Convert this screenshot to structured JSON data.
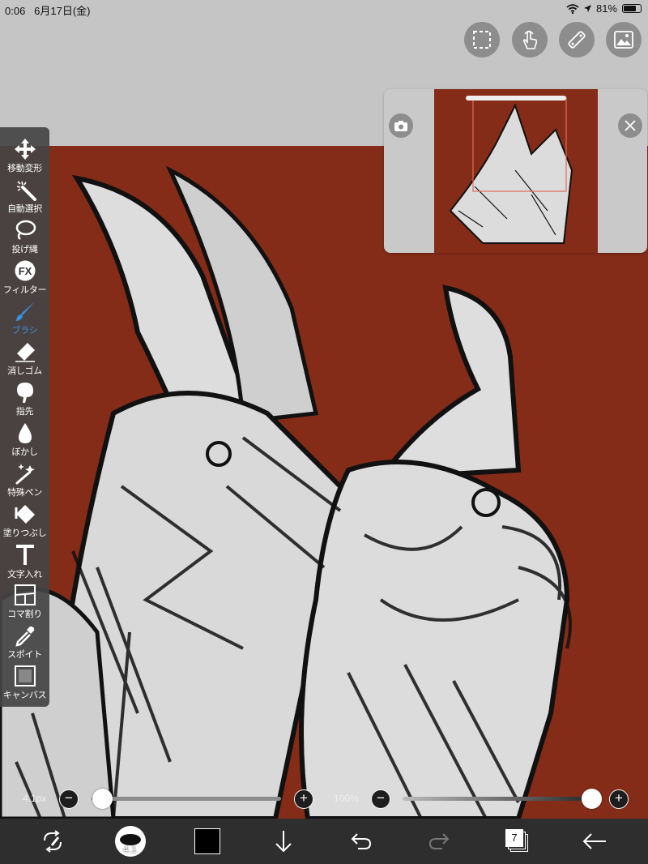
{
  "status_bar": {
    "time": "0:06",
    "date": "6月17日(金)",
    "battery": "81%",
    "battery_level": 0.81
  },
  "top_tools": [
    {
      "name": "selection-icon"
    },
    {
      "name": "gesture-icon"
    },
    {
      "name": "ruler-icon"
    },
    {
      "name": "gallery-icon"
    }
  ],
  "navigator": {
    "camera_icon": "camera-icon",
    "close_icon": "close-icon"
  },
  "toolbar": {
    "active": "brush",
    "items": [
      {
        "id": "move",
        "label": "移動変形",
        "icon": "move-icon"
      },
      {
        "id": "magic",
        "label": "自動選択",
        "icon": "magic-wand-icon"
      },
      {
        "id": "lasso",
        "label": "投げ縄",
        "icon": "lasso-icon"
      },
      {
        "id": "filter",
        "label": "フィルター",
        "icon": "fx-icon"
      },
      {
        "id": "brush",
        "label": "ブラシ",
        "icon": "brush-icon"
      },
      {
        "id": "eraser",
        "label": "消しゴム",
        "icon": "eraser-icon"
      },
      {
        "id": "smudge",
        "label": "指先",
        "icon": "finger-icon"
      },
      {
        "id": "blur",
        "label": "ぼかし",
        "icon": "blur-drop-icon"
      },
      {
        "id": "special",
        "label": "特殊ペン",
        "icon": "special-pen-icon"
      },
      {
        "id": "fill",
        "label": "塗りつぶし",
        "icon": "bucket-icon"
      },
      {
        "id": "text",
        "label": "文字入れ",
        "icon": "text-icon"
      },
      {
        "id": "frame",
        "label": "コマ割り",
        "icon": "frame-divider-icon"
      },
      {
        "id": "eyedropper",
        "label": "スポイト",
        "icon": "eyedropper-icon"
      },
      {
        "id": "canvas",
        "label": "キャンバス",
        "icon": "canvas-icon"
      }
    ]
  },
  "brush_size": {
    "label": "4.1px",
    "minus": "−",
    "plus": "+",
    "level": 0.05
  },
  "opacity": {
    "label": "100%",
    "minus": "−",
    "plus": "+",
    "level": 1.0
  },
  "bottom_bar": {
    "brush_size_badge": "4.1",
    "layer_count": "7",
    "primary_color": "#000000"
  },
  "colors": {
    "canvas_bg": "#842c18",
    "accent": "#3d8fe0",
    "toolbar_bg": "#444444"
  }
}
